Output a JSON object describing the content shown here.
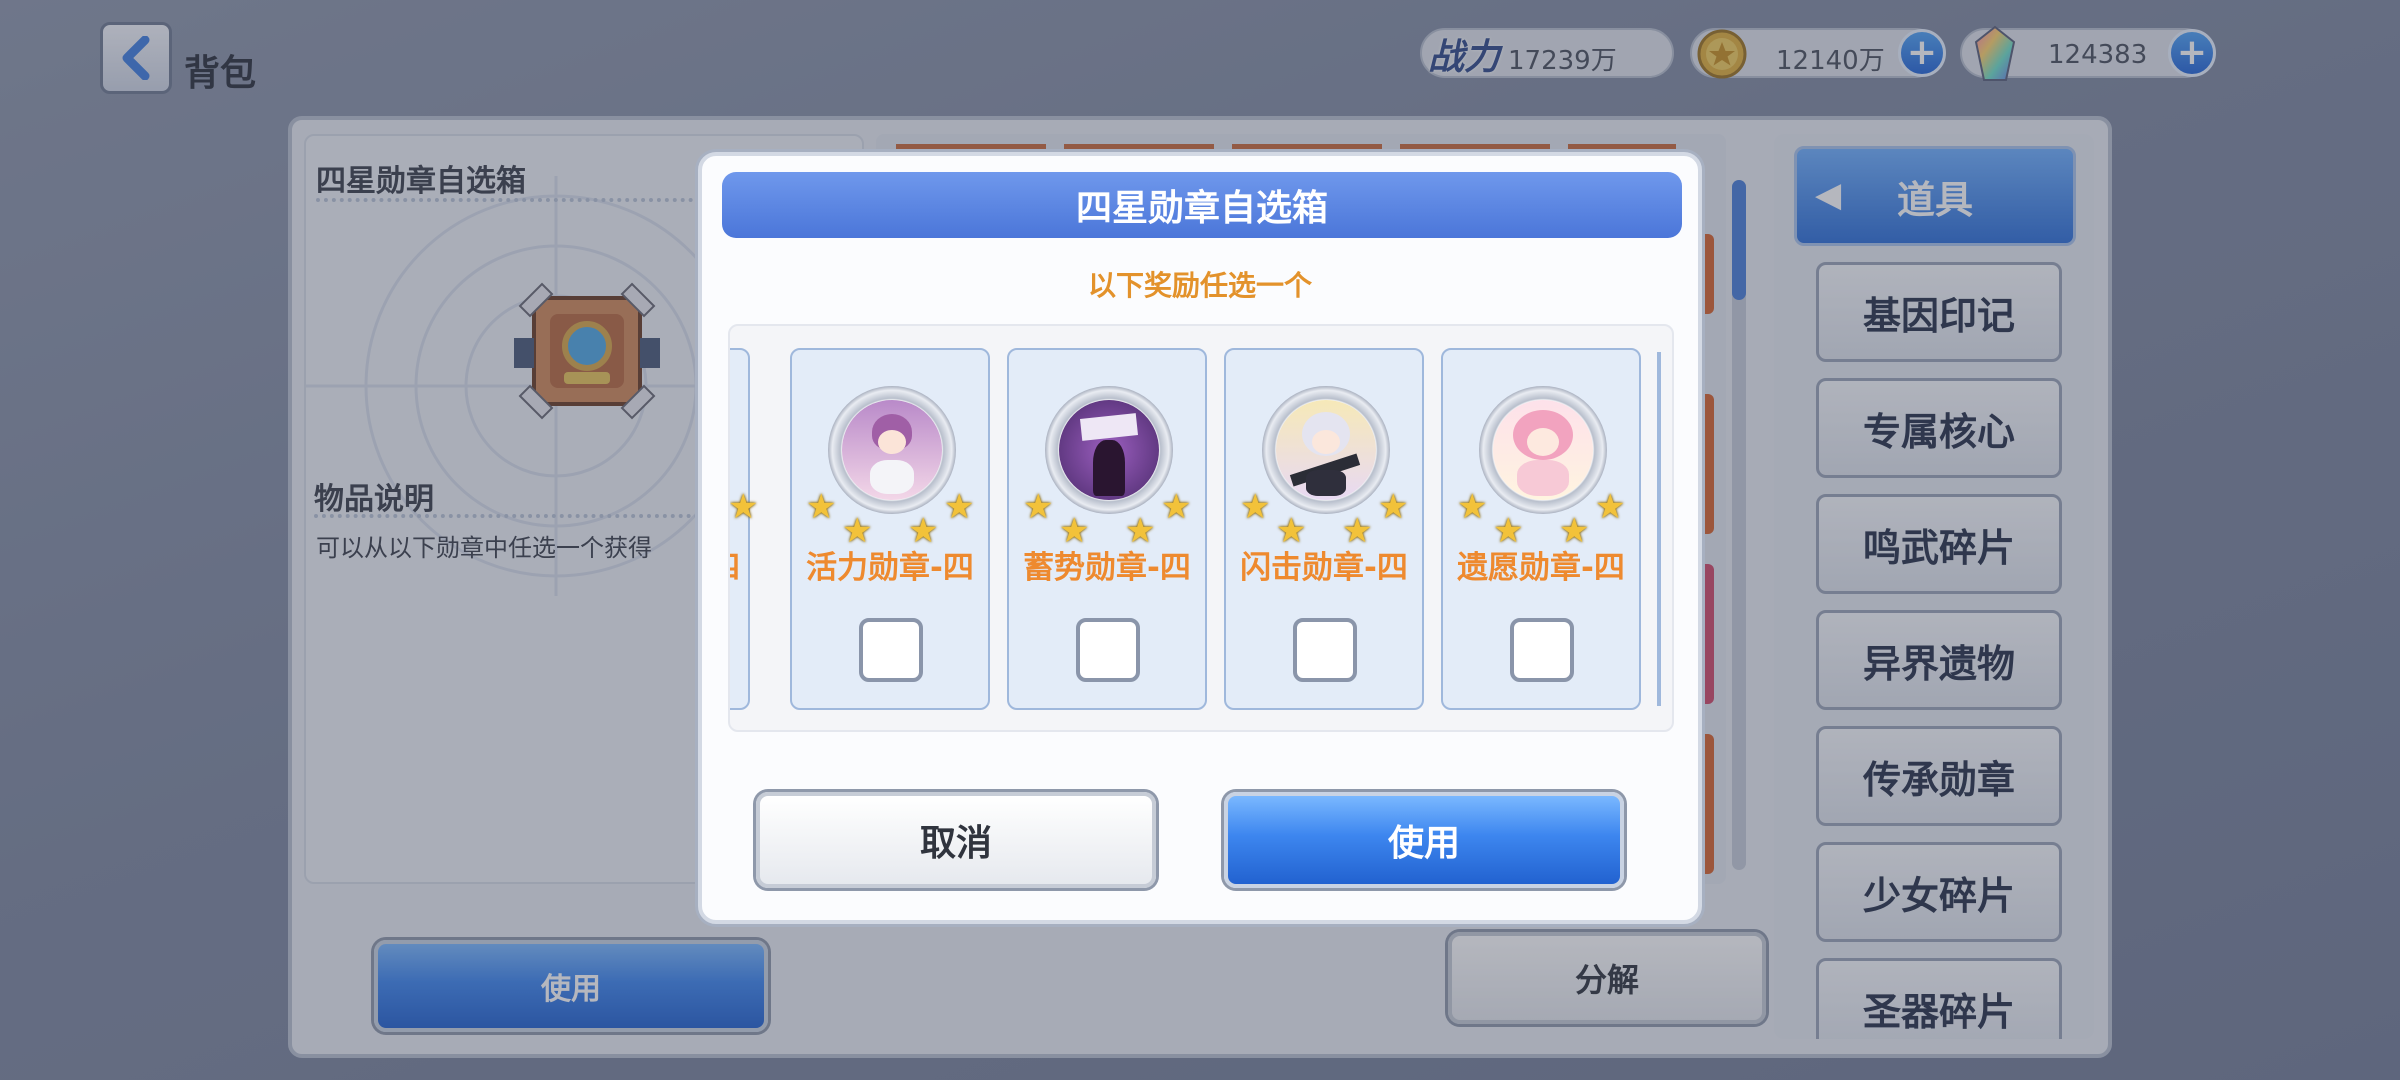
{
  "header": {
    "title": "背包",
    "power_label": "战力",
    "power_value": "17239万",
    "gold_value": "12140万",
    "gem_value": "124383"
  },
  "left_panel": {
    "item_name": "四星勋章自选箱",
    "desc_title": "物品说明",
    "desc_text": "可以从以下勋章中任选一个获得",
    "use_label": "使用",
    "decompose_label": "分解"
  },
  "nav": {
    "active": "道具",
    "items": [
      "基因印记",
      "专属核心",
      "鸣武碎片",
      "异界遗物",
      "传承勋章",
      "少女碎片",
      "圣器碎片"
    ]
  },
  "dialog": {
    "title": "四星勋章自选箱",
    "subtitle": "以下奖励任选一个",
    "partial_card_label": "四",
    "options": [
      {
        "name": "活力勋章-四",
        "stars": 4,
        "checked": false
      },
      {
        "name": "蓄势勋章-四",
        "stars": 4,
        "checked": false
      },
      {
        "name": "闪击勋章-四",
        "stars": 4,
        "checked": false
      },
      {
        "name": "遗愿勋章-四",
        "stars": 4,
        "checked": false
      }
    ],
    "cancel_label": "取消",
    "confirm_label": "使用"
  },
  "colors": {
    "accent_blue": "#3d86ef",
    "option_name": "#ee8a2f",
    "subtitle": "#e3922b"
  }
}
